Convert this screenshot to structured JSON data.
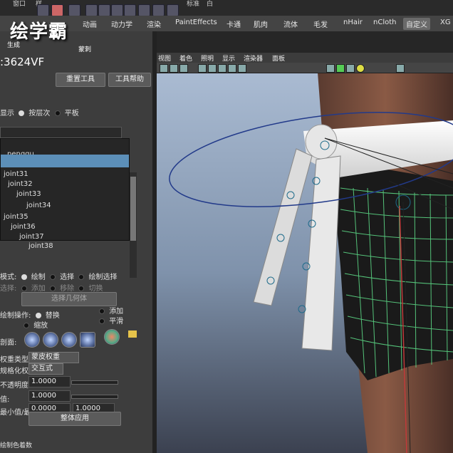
{
  "app": {
    "menu_items": [
      "窗口",
      "样",
      "标准",
      "白"
    ],
    "shelf_tabs": [
      "动画",
      "动力学",
      "渲染",
      "PaintEffects",
      "卡通",
      "肌肉",
      "流体",
      "毛发",
      "nHair",
      "nCloth",
      "自定义",
      "XG"
    ],
    "shelf_active": "自定义"
  },
  "overlay": {
    "logo": "绘学霸",
    "version": ":3624VF",
    "small_labels": [
      "生成",
      "蒙刺"
    ]
  },
  "panel": {
    "reset_tool": "重置工具",
    "tool_help": "工具帮助",
    "display_label": "显示",
    "hierarchy_option": "按层次",
    "flat_option": "平板",
    "tree_items": [
      "_penggu",
      "joint31",
      "joint32",
      "joint33",
      "joint34",
      "joint35",
      "joint36",
      "joint37",
      "joint38"
    ],
    "mode_label": "模式:",
    "mode_paint": "绘制",
    "mode_select": "选择",
    "mode_paint_select": "绘制选择",
    "select_label": "选择:",
    "select_add": "添加",
    "select_remove": "移除",
    "select_toggle": "切换",
    "select_geometry": "选择几何体",
    "paint_op_label": "绘制操作:",
    "op_replace": "替换",
    "op_add": "添加",
    "op_scale": "缩放",
    "op_smooth": "平滑",
    "profile_label": "剖面:",
    "weight_type_label": "权重类型:",
    "weight_type_value": "蒙皮权重",
    "normalize_label": "规格化权重:",
    "normalize_value": "交互式",
    "opacity_label": "不透明度:",
    "opacity_value": "1.0000",
    "value_label": "值:",
    "value_value": "1.0000",
    "minmax_label": "最小值/最大值:",
    "min_value": "0.0000",
    "max_value": "1.0000",
    "flood_button": "整体应用",
    "bottom_label": "绘制色着数"
  },
  "viewport": {
    "menu": [
      "视图",
      "着色",
      "照明",
      "显示",
      "渲染器",
      "面板"
    ]
  }
}
